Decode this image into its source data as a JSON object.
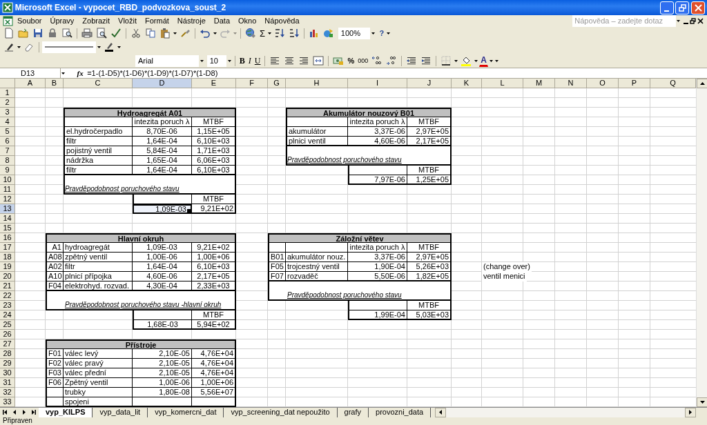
{
  "window": {
    "title": "Microsoft Excel - vypocet_RBD_podvozkova_soust_2"
  },
  "menu": [
    {
      "label": "Soubor"
    },
    {
      "label": "Úpravy"
    },
    {
      "label": "Zobrazit"
    },
    {
      "label": "Vložit"
    },
    {
      "label": "Formát"
    },
    {
      "label": "Nástroje"
    },
    {
      "label": "Data"
    },
    {
      "label": "Okno"
    },
    {
      "label": "Nápověda"
    }
  ],
  "help_search": {
    "placeholder": "Nápověda – zadejte dotaz"
  },
  "standard_toolbar": {
    "sum": "Σ",
    "zoom": "100%",
    "help": "?"
  },
  "format_toolbar": {
    "font": "Arial",
    "size": "10",
    "bold": "B",
    "italic": "I",
    "underline": "U",
    "percent": "%",
    "thousands": "000",
    "font_color": "A"
  },
  "formula_bar": {
    "name_box": "D13",
    "fx": "fx",
    "formula": "=1-(1-D5)*(1-D6)*(1-D9)*(1-D7)*(1-D8)"
  },
  "sheet": {
    "columns": [
      "A",
      "B",
      "C",
      "D",
      "E",
      "F",
      "G",
      "H",
      "I",
      "J",
      "K",
      "L",
      "M",
      "N",
      "O",
      "P",
      "Q"
    ],
    "rows": [
      "1",
      "2",
      "3",
      "4",
      "5",
      "6",
      "7",
      "8",
      "9",
      "10",
      "11",
      "12",
      "13",
      "14",
      "15",
      "16",
      "17",
      "18",
      "19",
      "20",
      "21",
      "22",
      "23",
      "24",
      "25",
      "26",
      "27",
      "28",
      "29",
      "30",
      "31",
      "32",
      "33"
    ],
    "tables": [
      {
        "title": "Hydroagregát A01",
        "header": [
          "intezita poruch λ",
          "MTBF"
        ],
        "rows": [
          {
            "name": "el.hydročerpadlo",
            "rate": "8,70E-06",
            "mtbf": "1,15E+05"
          },
          {
            "name": "filtr",
            "rate": "1,64E-04",
            "mtbf": "6,10E+03"
          },
          {
            "name": "pojistný ventil",
            "rate": "5,84E-04",
            "mtbf": "1,71E+03"
          },
          {
            "name": "nádržka",
            "rate": "1,65E-04",
            "mtbf": "6,06E+03"
          },
          {
            "name": "filtr",
            "rate": "1,64E-04",
            "mtbf": "6,10E+03"
          }
        ],
        "note": "Pravděpodobnost poruchového stavu",
        "result": {
          "header": "MTBF",
          "rate": {
            "text": "1,09E-03",
            "selected": true
          },
          "mtbf": {
            "text": "9,21E+02",
            "selected": false
          }
        }
      },
      {
        "title": "Akumulátor nouzový B01",
        "header": [
          "intezita poruch λ",
          "MTBF"
        ],
        "rows": [
          {
            "name": "akumulátor",
            "rate": "3,37E-06",
            "mtbf": "2,97E+05"
          },
          {
            "name": "plnici ventil",
            "rate": "4,60E-06",
            "mtbf": "2,17E+05"
          }
        ],
        "note": "Pravděpodobnost poruchového stavu",
        "result": {
          "header": "MTBF",
          "rate": {
            "text": "7,97E-06",
            "selected": false
          },
          "mtbf": {
            "text": "1,25E+05",
            "selected": false
          }
        }
      },
      {
        "title": "Hlavní okruh",
        "rows": [
          {
            "code": "A1",
            "name": "hydroagregát",
            "rate": "1,09E-03",
            "mtbf": "9,21E+02"
          },
          {
            "code": "A08",
            "name": "zpětný ventil",
            "rate": "1,00E-06",
            "mtbf": "1,00E+06"
          },
          {
            "code": "A02",
            "name": "filtr",
            "rate": "1,64E-04",
            "mtbf": "6,10E+03"
          },
          {
            "code": "A10",
            "name": "plnicí přípojka",
            "rate": "4,60E-06",
            "mtbf": "2,17E+05"
          },
          {
            "code": "F04",
            "name": "elektrohyd. rozvad.",
            "rate": "4,30E-04",
            "mtbf": "2,33E+03"
          }
        ],
        "note": "Pravděpodobnost poruchového stavu -hlavní okruh",
        "result": {
          "header": "MTBF",
          "rate": {
            "text": "1,68E-03",
            "selected": false
          },
          "mtbf": {
            "text": "5,94E+02",
            "selected": false
          }
        }
      },
      {
        "title": "Záložní větev",
        "header": [
          "intezita poruch λ",
          "MTBF"
        ],
        "rows": [
          {
            "code": "B01",
            "name": "akumulátor nouz.",
            "rate": "3,37E-06",
            "mtbf": "2,97E+05"
          },
          {
            "code": "F05",
            "name": "trojcestný ventil",
            "rate": "1,90E-04",
            "mtbf": "5,26E+03"
          },
          {
            "code": "F07",
            "name": "rozvaděč",
            "rate": "5,50E-06",
            "mtbf": "1,82E+05"
          }
        ],
        "note": "Pravděpodobnost poruchového stavu",
        "result": {
          "header": "MTBF",
          "rate": {
            "text": "1,99E-04",
            "selected": false
          },
          "mtbf": {
            "text": "5,03E+03",
            "selected": false
          }
        }
      },
      {
        "title": "Přístroje",
        "rows": [
          {
            "code": "F01",
            "name": "válec levý",
            "rate": "2,10E-05",
            "mtbf": "4,76E+04"
          },
          {
            "code": "F02",
            "name": "válec pravý",
            "rate": "2,10E-05",
            "mtbf": "4,76E+04"
          },
          {
            "code": "F03",
            "name": "válec přední",
            "rate": "2,10E-05",
            "mtbf": "4,76E+04"
          },
          {
            "code": "F06",
            "name": "Zpětný ventil",
            "rate": "1,00E-06",
            "mtbf": "1,00E+06"
          },
          {
            "name": "trubky",
            "rate": "1,80E-08",
            "mtbf": "5,56E+07"
          },
          {
            "name": "spojeni"
          }
        ]
      }
    ],
    "side_notes": [
      "(change over)",
      "ventil menici"
    ]
  },
  "sheet_tabs": [
    {
      "label": "vyp_KILPS",
      "selected": true
    },
    {
      "label": "vyp_data_lit",
      "selected": false
    },
    {
      "label": "vyp_komercni_dat",
      "selected": false
    },
    {
      "label": "vyp_screening_dat nepoužito",
      "selected": false
    },
    {
      "label": "grafy",
      "selected": false
    },
    {
      "label": "provozni_data",
      "selected": false
    }
  ],
  "status_bar": {
    "text": "Připraven"
  }
}
